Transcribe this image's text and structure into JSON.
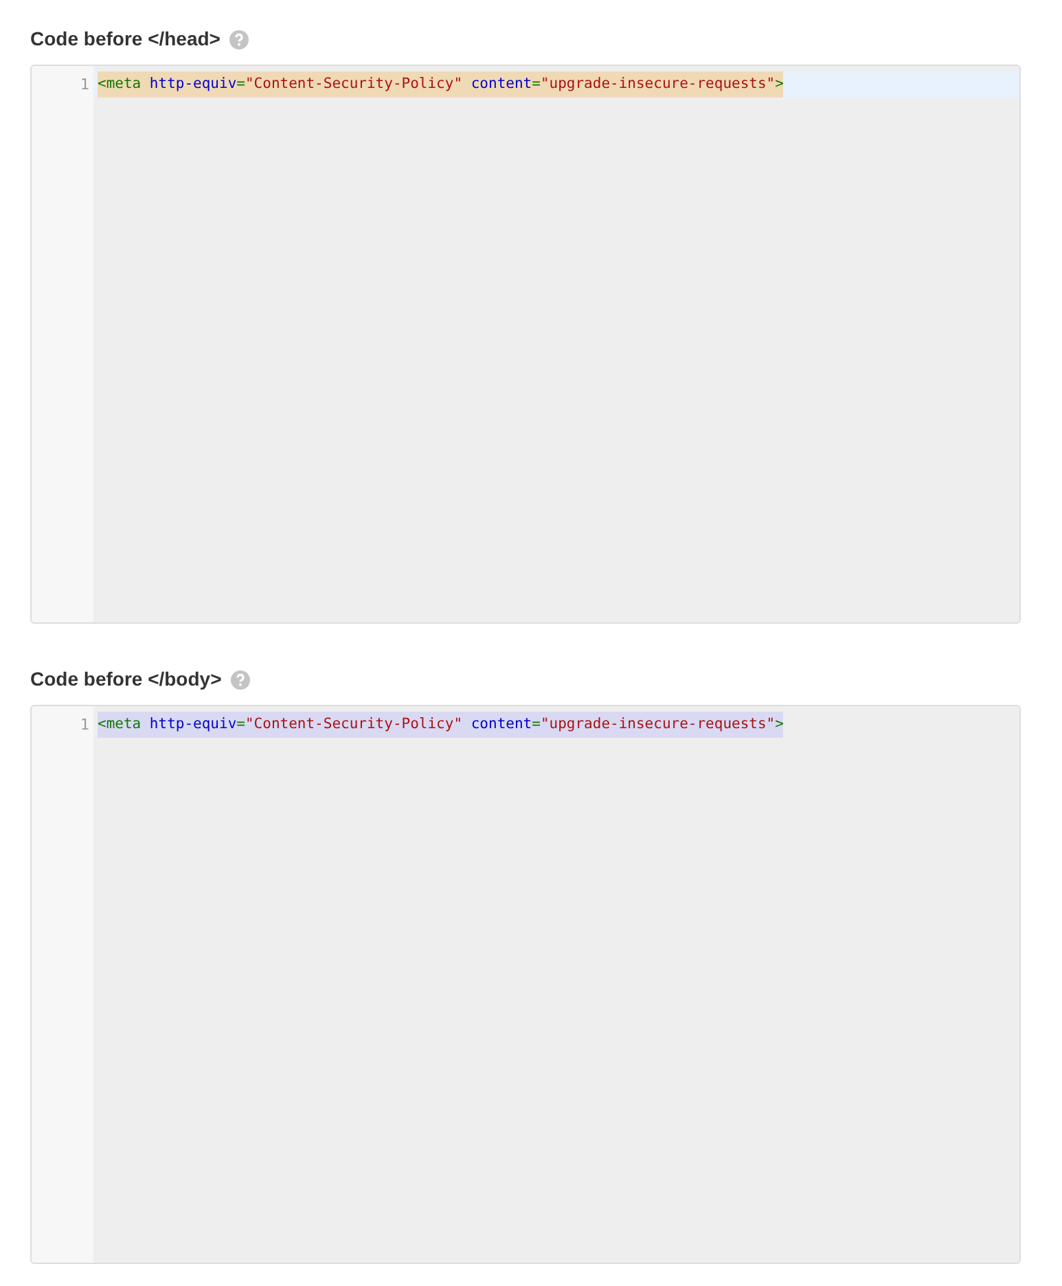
{
  "editors": [
    {
      "label": "Code before </head>",
      "focused": true,
      "lines": [
        {
          "number": "1",
          "selected": true,
          "tokens": [
            {
              "kind": "tag",
              "text": "<meta"
            },
            {
              "kind": "attr",
              "text": " http-equiv"
            },
            {
              "kind": "punct",
              "text": "="
            },
            {
              "kind": "string",
              "text": "\"Content-Security-Policy\""
            },
            {
              "kind": "attr",
              "text": " content"
            },
            {
              "kind": "punct",
              "text": "="
            },
            {
              "kind": "string",
              "text": "\"upgrade-insecure-requests\""
            },
            {
              "kind": "tag",
              "text": ">"
            }
          ]
        }
      ]
    },
    {
      "label": "Code before </body>",
      "focused": false,
      "lines": [
        {
          "number": "1",
          "selected": true,
          "tokens": [
            {
              "kind": "tag",
              "text": "<meta"
            },
            {
              "kind": "attr",
              "text": " http-equiv"
            },
            {
              "kind": "punct",
              "text": "="
            },
            {
              "kind": "string",
              "text": "\"Content-Security-Policy\""
            },
            {
              "kind": "attr",
              "text": " content"
            },
            {
              "kind": "punct",
              "text": "="
            },
            {
              "kind": "string",
              "text": "\"upgrade-insecure-requests\""
            },
            {
              "kind": "tag",
              "text": ">"
            }
          ]
        }
      ]
    }
  ]
}
